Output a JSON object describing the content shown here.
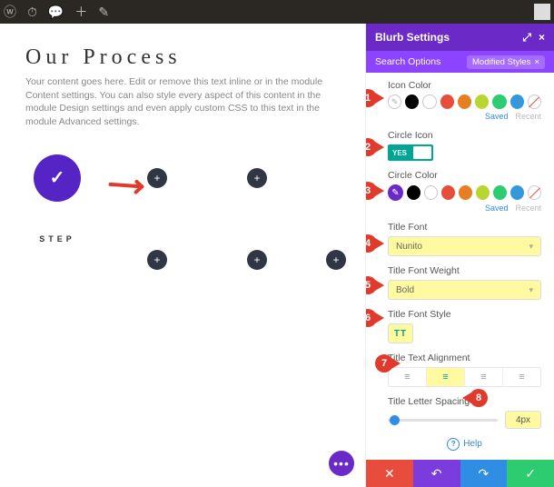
{
  "adminbar": {
    "icons": [
      "wp",
      "dash",
      "comment",
      "plus",
      "pencil"
    ]
  },
  "editor": {
    "heading": "Our Process",
    "description": "Your content goes here. Edit or remove this text inline or in the module Content settings. You can also style every aspect of this content in the module Design settings and even apply custom CSS to this text in the module Advanced settings.",
    "step_caption": "STEP",
    "fab": "•••"
  },
  "panel": {
    "title": "Blurb Settings",
    "search_label": "Search Options",
    "modified_tag": "Modified Styles",
    "sections": {
      "icon_color": {
        "label": "Icon Color",
        "saved": "Saved",
        "recent": "Recent"
      },
      "circle_icon": {
        "label": "Circle Icon",
        "toggle": "YES"
      },
      "circle_color": {
        "label": "Circle Color",
        "saved": "Saved",
        "recent": "Recent"
      },
      "title_font": {
        "label": "Title Font",
        "value": "Nunito"
      },
      "title_weight": {
        "label": "Title Font Weight",
        "value": "Bold"
      },
      "title_style": {
        "label": "Title Font Style",
        "value": "TT"
      },
      "title_align": {
        "label": "Title Text Alignment"
      },
      "letter_spacing": {
        "label": "Title Letter Spacing",
        "value": "4px"
      }
    },
    "help": "Help",
    "swatch_colors": [
      "#000000",
      "#ffffff",
      "#e74c3c",
      "#e67e22",
      "#f1c40f",
      "#2ecc71",
      "#1abc9c",
      "#3498db",
      "#9b59b6"
    ],
    "accent": "#6b29c7"
  },
  "callouts": [
    "1",
    "2",
    "3",
    "4",
    "5",
    "6",
    "7",
    "8"
  ]
}
